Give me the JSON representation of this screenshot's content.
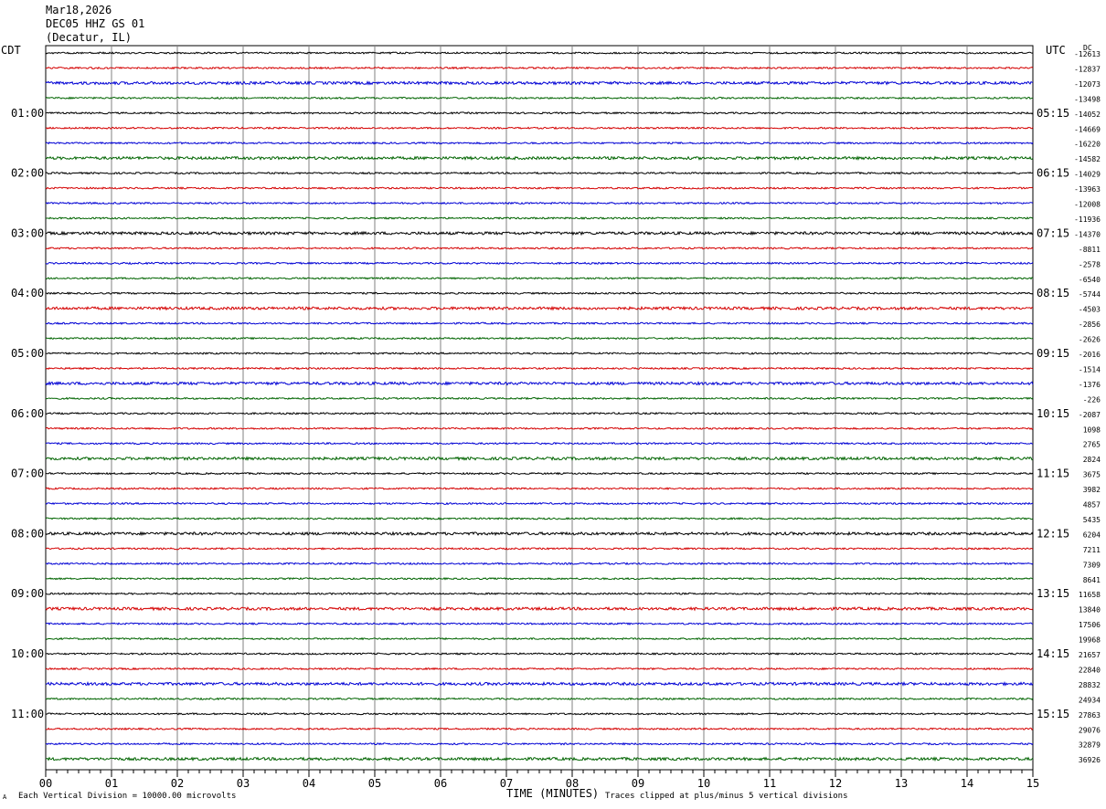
{
  "header": {
    "date": "Mar18,2026",
    "station": "DEC05 HHZ GS 01",
    "location": "(Decatur, IL)"
  },
  "left_zone": "CDT",
  "right_zone": "UTC",
  "dc_label": "DC",
  "footer": {
    "scale_note": "Each Vertical Division = 10000.00 microvolts",
    "clip_note": "Traces clipped at plus/minus 5 vertical divisions",
    "marker": "A"
  },
  "colors": {
    "trace": [
      "#000000",
      "#d40000",
      "#0000d4",
      "#006400"
    ],
    "grid": "#808080"
  },
  "chart_data": {
    "type": "line",
    "title": "DEC05 HHZ GS 01",
    "xlabel": "TIME (MINUTES)",
    "xlim": [
      0,
      15
    ],
    "xticks": [
      "00",
      "01",
      "02",
      "03",
      "04",
      "05",
      "06",
      "07",
      "08",
      "09",
      "10",
      "11",
      "12",
      "13",
      "14",
      "15"
    ],
    "left_time_labels": [
      "01:00",
      "02:00",
      "03:00",
      "04:00",
      "05:00",
      "06:00",
      "07:00",
      "08:00",
      "09:00",
      "10:00",
      "11:00"
    ],
    "right_time_labels": [
      "05:15",
      "06:15",
      "07:15",
      "08:15",
      "09:15",
      "10:15",
      "11:15",
      "12:15",
      "13:15",
      "14:15",
      "15:15"
    ],
    "trace_rows": 48,
    "dc_offsets": [
      "-12613",
      "-12837",
      "-12073",
      "-13498",
      "-14052",
      "-14669",
      "-16220",
      "-14582",
      "-14029",
      "-13963",
      "-12008",
      "-11936",
      "-14370",
      "-8811",
      "-2578",
      "-6540",
      "-5744",
      "-4503",
      "-2856",
      "-2626",
      "-2016",
      "-1514",
      "-1376",
      "-226",
      "-2087",
      "1098",
      "2765",
      "2824",
      "3675",
      "3982",
      "4857",
      "5435",
      "6204",
      "7211",
      "7309",
      "8641",
      "11658",
      "13840",
      "17506",
      "19968",
      "21657",
      "22840",
      "28832",
      "24934",
      "27863",
      "29076",
      "32879",
      "36926"
    ]
  }
}
